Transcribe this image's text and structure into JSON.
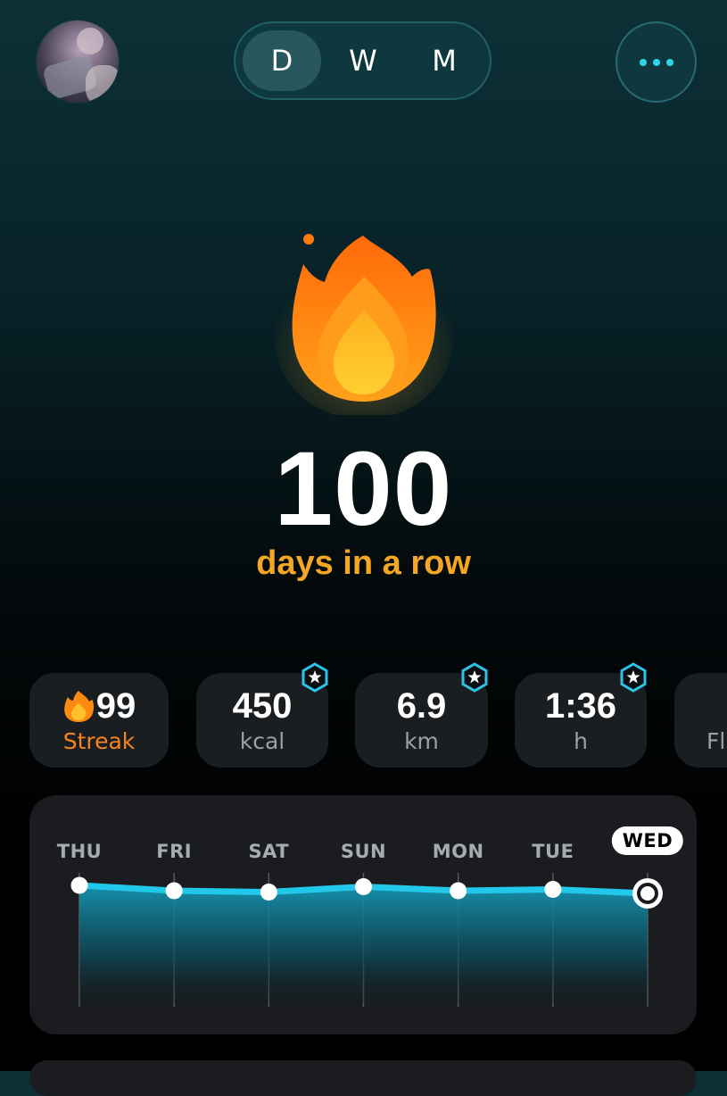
{
  "header": {
    "period_tabs": [
      {
        "label": "D",
        "active": true
      },
      {
        "label": "W",
        "active": false
      },
      {
        "label": "M",
        "active": false
      }
    ],
    "more_icon": "more-dots-icon",
    "avatar_icon": "user-avatar"
  },
  "streak": {
    "count": "100",
    "subtitle": "days in a row",
    "icon": "flame-icon"
  },
  "stats": [
    {
      "value": "99",
      "unit": "Streak",
      "icon": "flame-icon",
      "badge": false
    },
    {
      "value": "450",
      "unit": "kcal",
      "badge": true
    },
    {
      "value": "6.9",
      "unit": "km",
      "badge": true
    },
    {
      "value": "1:36",
      "unit": "h",
      "badge": true
    },
    {
      "value": "",
      "unit": "Fl",
      "badge": false
    }
  ],
  "chart_data": {
    "type": "area",
    "categories": [
      "THU",
      "FRI",
      "SAT",
      "SUN",
      "MON",
      "TUE",
      "WED"
    ],
    "values": [
      0.96,
      0.94,
      0.935,
      0.955,
      0.94,
      0.945,
      0.93
    ],
    "highlighted": "WED",
    "grid": true
  },
  "colors": {
    "accent": "#f5a623",
    "streak_orange": "#f5841f",
    "line_cyan": "#22c8ea",
    "card_bg": "#1b1e21"
  }
}
